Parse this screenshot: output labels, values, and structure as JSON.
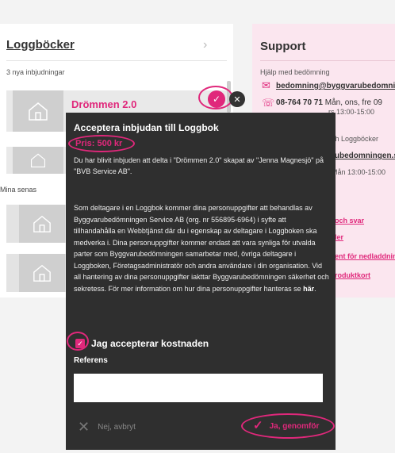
{
  "loggbocker": {
    "title": "Loggböcker",
    "chevron": "›",
    "invites_count": "3 nya inbjudningar",
    "invite_title": "Drömmen 2.0",
    "recent_label": "Mina senas"
  },
  "support": {
    "title": "Support",
    "help_bedomning": "Hjälp med bedömning",
    "email_bedomning": "bedomning@byggvarubedomningen.se",
    "phone_bedomning": "08-764 70 71",
    "hours_bedomning_1": "Mån, ons, fre 09",
    "hours_bedomning_2": "rs 13:00-15:00",
    "help_loggbocker": "ch Loggböcker",
    "email_loggbocker": "rubedomningen.se",
    "hours_loggbocker": "Mån 13:00-15:00",
    "link_faq": "och svar",
    "link_2": "ler",
    "link_3": "ent för nedladdning",
    "link_4": "roduktkort"
  },
  "modal": {
    "title": "Acceptera inbjudan till Loggbok",
    "price": "Pris: 500 kr",
    "intro": "Du har blivit inbjuden att delta i \"Drömmen 2.0\" skapat av \"Jenna Magnesjö\" på \"BVB Service AB\".",
    "privacy": "Som deltagare i en Loggbok kommer dina personuppgifter att behandlas av Byggvarubedömningen Service AB (org. nr 556895-6964) i syfte att tillhandahålla en Webbtjänst där du i egenskap av deltagare i Loggboken ska medverka i. Dina personuppgifter kommer endast att vara synliga för utvalda parter som Byggvarubedömningen samarbetar med, övriga deltagare i Loggboken, Företagsadministratör och andra användare i din organisation. Vid all hantering av dina personuppgifter iakttar Byggvarubedömningen säkerhet och sekretess. För mer information om hur dina personuppgifter hanteras se",
    "privacy_link": "här",
    "privacy_end": ".",
    "accept_cost_label": "Jag accepterar kostnaden",
    "reference_label": "Referens",
    "reference_value": "",
    "cancel_label": "Nej, avbryt",
    "confirm_label": "Ja, genomför"
  },
  "colors": {
    "accent": "#e0287b",
    "modal_bg": "#2f2f2f",
    "support_bg": "#fbe6ef"
  }
}
